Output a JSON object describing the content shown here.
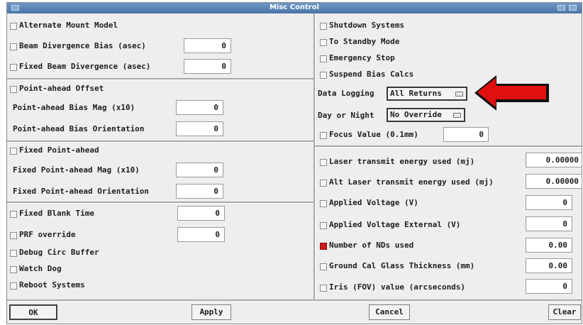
{
  "window": {
    "title": "Misc Control"
  },
  "left": {
    "alt_mount_model": "Alternate Mount Model",
    "beam_div_bias": "Beam Divergence Bias  (asec)",
    "beam_div_bias_value": "0",
    "fixed_beam_div": "Fixed Beam Divergence (asec)",
    "fixed_beam_div_value": "0",
    "point_ahead_offset": "Point-ahead Offset",
    "pa_bias_mag": "Point-ahead Bias Mag (x10)",
    "pa_bias_mag_value": "0",
    "pa_bias_orient": "Point-ahead Bias Orientation",
    "pa_bias_orient_value": "0",
    "fixed_pa": "Fixed Point-ahead",
    "fixed_pa_mag": "Fixed Point-ahead Mag (x10)",
    "fixed_pa_mag_value": "0",
    "fixed_pa_orient": "Fixed Point-ahead Orientation",
    "fixed_pa_orient_value": "0",
    "fixed_blank_time": "Fixed Blank Time",
    "fixed_blank_time_value": "0",
    "prf_override": "PRF override",
    "prf_override_value": "0",
    "debug_circ_buffer": "Debug Circ Buffer",
    "watch_dog": "Watch Dog",
    "reboot_systems": "Reboot Systems"
  },
  "right": {
    "shutdown_systems": "Shutdown Systems",
    "to_standby": "To Standby Mode",
    "emergency_stop": "Emergency Stop",
    "suspend_bias": "Suspend Bias Calcs",
    "data_logging_label": "Data Logging",
    "data_logging_value": "All Returns",
    "day_night_label": "Day or Night",
    "day_night_value": "No Override",
    "focus_value": "Focus Value  (0.1mm)",
    "focus_value_value": "0",
    "laser_energy": "Laser transmit energy used (mj)",
    "laser_energy_value": "0.00000",
    "alt_laser_energy": "Alt Laser transmit energy used (mj)",
    "alt_laser_energy_value": "0.00000",
    "applied_voltage": "Applied Voltage (V)",
    "applied_voltage_value": "0",
    "applied_voltage_ext": "Applied Voltage External (V)",
    "applied_voltage_ext_value": "0",
    "num_nds": "Number of NDs used",
    "num_nds_value": "0.00",
    "ground_cal": "Ground Cal Glass Thickness (mm)",
    "ground_cal_value": "0.00",
    "iris_fov": "Iris (FOV) value (arcseconds)",
    "iris_fov_value": "0"
  },
  "buttons": {
    "ok": "OK",
    "apply": "Apply",
    "cancel": "Cancel",
    "clear": "Clear"
  },
  "colors": {
    "title_bar": "#5a82b4",
    "active_checkbox": "#d11a1a",
    "arrow": "#e01010"
  }
}
